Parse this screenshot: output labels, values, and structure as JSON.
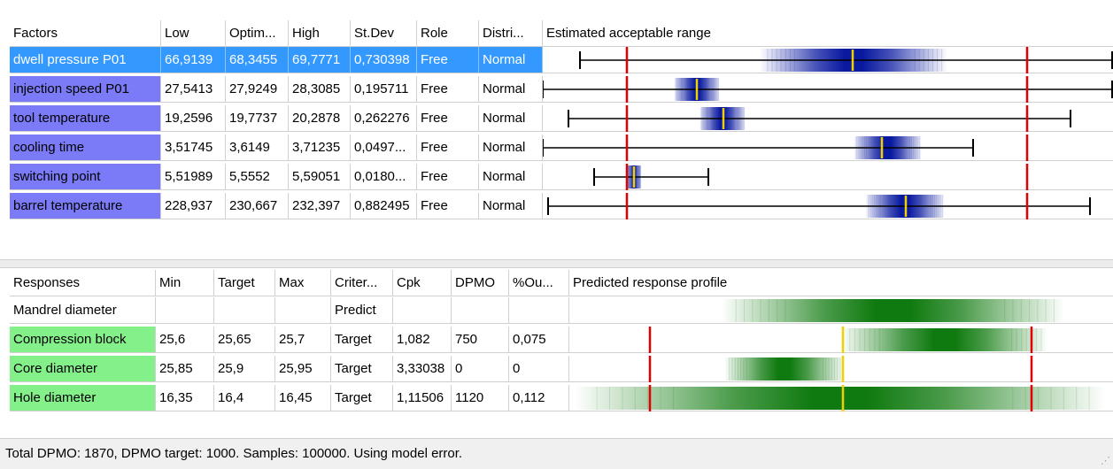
{
  "factors": {
    "headers": [
      "Factors",
      "Low",
      "Optim...",
      "High",
      "St.Dev",
      "Role",
      "Distri...",
      "Estimated acceptable range"
    ],
    "rows": [
      {
        "name": "dwell pressure P01",
        "low": "66,9139",
        "optim": "68,3455",
        "high": "69,7771",
        "stdev": "0,730398",
        "role": "Free",
        "dist": "Normal",
        "selected": true
      },
      {
        "name": "injection speed P01",
        "low": "27,5413",
        "optim": "27,9249",
        "high": "28,3085",
        "stdev": "0,195711",
        "role": "Free",
        "dist": "Normal",
        "selected": false
      },
      {
        "name": "tool temperature",
        "low": "19,2596",
        "optim": "19,7737",
        "high": "20,2878",
        "stdev": "0,262276",
        "role": "Free",
        "dist": "Normal",
        "selected": false
      },
      {
        "name": "cooling time",
        "low": "3,51745",
        "optim": "3,6149",
        "high": "3,71235",
        "stdev": "0,0497...",
        "role": "Free",
        "dist": "Normal",
        "selected": false
      },
      {
        "name": "switching point",
        "low": "5,51989",
        "optim": "5,5552",
        "high": "5,59051",
        "stdev": "0,0180...",
        "role": "Free",
        "dist": "Normal",
        "selected": false
      },
      {
        "name": "barrel temperature",
        "low": "228,937",
        "optim": "230,667",
        "high": "232,397",
        "stdev": "0,882495",
        "role": "Free",
        "dist": "Normal",
        "selected": false
      }
    ]
  },
  "responses": {
    "headers": [
      "Responses",
      "Min",
      "Target",
      "Max",
      "Criter...",
      "Cpk",
      "DPMO",
      "%Ou...",
      "Predicted response profile"
    ],
    "rows": [
      {
        "name": "Mandrel diameter",
        "min": "",
        "target": "",
        "max": "",
        "criterion": "Predict",
        "cpk": "",
        "dpmo": "",
        "pctout": "",
        "highlight": false
      },
      {
        "name": "Compression block",
        "min": "25,6",
        "target": "25,65",
        "max": "25,7",
        "criterion": "Target",
        "cpk": "1,082",
        "dpmo": "750",
        "pctout": "0,075",
        "highlight": true
      },
      {
        "name": "Core diameter",
        "min": "25,85",
        "target": "25,9",
        "max": "25,95",
        "criterion": "Target",
        "cpk": "3,33038",
        "dpmo": "0",
        "pctout": "0",
        "highlight": true
      },
      {
        "name": "Hole diameter",
        "min": "16,35",
        "target": "16,4",
        "max": "16,45",
        "criterion": "Target",
        "cpk": "1,11506",
        "dpmo": "1120",
        "pctout": "0,112",
        "highlight": true
      }
    ]
  },
  "status": {
    "text": "Total DPMO: 1870,  DPMO target: 1000.  Samples: 100000. Using model error."
  },
  "colors": {
    "factor_band": "#0a1aa0",
    "response_band": "#0f7a0f",
    "limit_line": "#e00000",
    "optimum_line": "#f0d000",
    "factor_name_bg": "#7b7bf7",
    "response_name_bg": "#84f08a",
    "selection": "#3399ff"
  },
  "range_plots": [
    {
      "whisker": [
        0.065,
        0.998
      ],
      "limits": [
        0.148,
        0.85
      ],
      "band": [
        0.38,
        0.71
      ],
      "optimum": 0.544
    },
    {
      "whisker": [
        0.0,
        0.998
      ],
      "limits": [
        0.148,
        0.85
      ],
      "band": [
        0.23,
        0.31
      ],
      "optimum": 0.27
    },
    {
      "whisker": [
        0.045,
        0.925
      ],
      "limits": [
        0.148,
        0.85
      ],
      "band": [
        0.275,
        0.355
      ],
      "optimum": 0.317
    },
    {
      "whisker": [
        0.0,
        0.755
      ],
      "limits": [
        0.148,
        0.85
      ],
      "band": [
        0.545,
        0.665
      ],
      "optimum": 0.595
    },
    {
      "whisker": [
        0.09,
        0.29
      ],
      "limits": [
        0.148,
        0.85
      ],
      "band": [
        0.148,
        0.172
      ],
      "optimum": 0.16
    },
    {
      "whisker": [
        0.01,
        0.96
      ],
      "limits": [
        0.148,
        0.85
      ],
      "band": [
        0.565,
        0.705
      ],
      "optimum": 0.636
    }
  ],
  "profile_plots": [
    {
      "limits": [],
      "band": [
        0.28,
        0.91
      ],
      "target": null
    },
    {
      "limits": [
        0.148,
        0.85
      ],
      "band": [
        0.5,
        0.88
      ],
      "target": 0.504
    },
    {
      "limits": [
        0.148,
        0.85
      ],
      "band": [
        0.285,
        0.505
      ],
      "target": 0.504
    },
    {
      "limits": [
        0.148,
        0.85
      ],
      "band": [
        0.01,
        0.985
      ],
      "target": 0.504
    }
  ]
}
